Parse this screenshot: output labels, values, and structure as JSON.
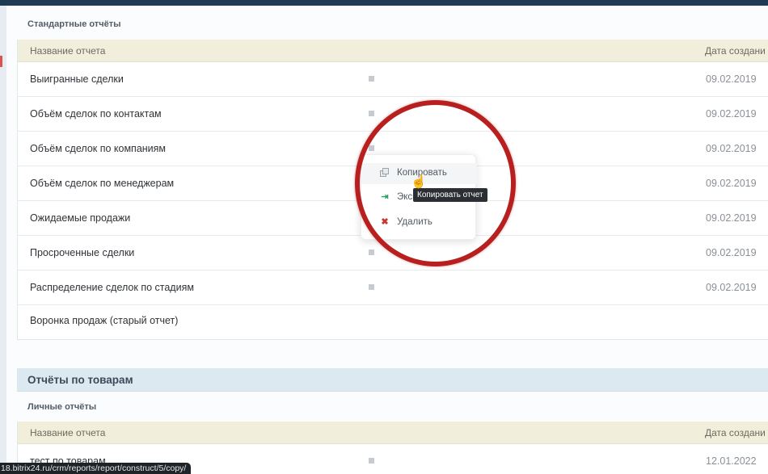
{
  "standard_reports": {
    "title": "Стандартные отчёты",
    "columns": {
      "name": "Название отчета",
      "date": "Дата создани"
    },
    "rows": [
      {
        "name": "Выигранные сделки",
        "date": "09.02.2019"
      },
      {
        "name": "Объём сделок по контактам",
        "date": "09.02.2019"
      },
      {
        "name": "Объём сделок по компаниям",
        "date": "09.02.2019"
      },
      {
        "name": "Объём сделок по менеджерам",
        "date": "09.02.2019"
      },
      {
        "name": "Ожидаемые продажи",
        "date": "09.02.2019"
      },
      {
        "name": "Просроченные сделки",
        "date": "09.02.2019"
      },
      {
        "name": "Распределение сделок по стадиям",
        "date": "09.02.2019"
      },
      {
        "name": "Воронка продаж (старый отчет)",
        "date": ""
      }
    ]
  },
  "product_reports": {
    "title": "Отчёты по товарам",
    "personal_title": "Личные отчёты",
    "columns": {
      "name": "Название отчета",
      "date": "Дата создани"
    },
    "rows": [
      {
        "name": "тест по товарам",
        "date": "12.01.2022"
      }
    ]
  },
  "context_menu": {
    "items": [
      {
        "label": "Копировать",
        "icon": "copy-icon"
      },
      {
        "label": "Экспорт",
        "icon": "export-icon"
      },
      {
        "label": "Удалить",
        "icon": "delete-icon"
      }
    ],
    "tooltip": "Копировать отчет"
  },
  "status_url": "18.bitrix24.ru/crm/reports/report/construct/5/copy/",
  "colors": {
    "table_header_bg": "#f2eedc",
    "section_header_bg": "#dde9f1",
    "highlight_circle": "#b8201f",
    "top_bar": "#1f3a52"
  }
}
